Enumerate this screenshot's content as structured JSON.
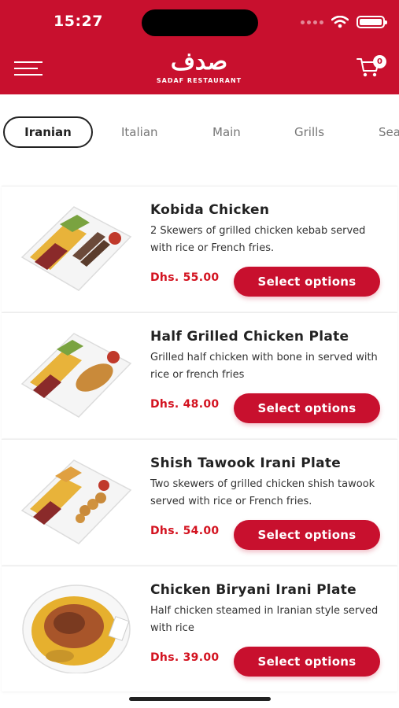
{
  "status_bar": {
    "time": "15:27"
  },
  "header": {
    "logo_mark": "صدف",
    "logo_sub": "SADAF RESTAURANT",
    "cart_count": "0"
  },
  "tabs": [
    {
      "label": "Iranian",
      "active": true
    },
    {
      "label": "Italian",
      "active": false
    },
    {
      "label": "Main",
      "active": false
    },
    {
      "label": "Grills",
      "active": false
    },
    {
      "label": "Sea",
      "active": false
    }
  ],
  "items": [
    {
      "title": "Kobida Chicken",
      "description": "2 Skewers of grilled chicken kebab served with rice or French fries.",
      "price": "Dhs. 55.00",
      "button": "Select options"
    },
    {
      "title": "Half Grilled Chicken Plate",
      "description": "Grilled half chicken with bone in served with rice or french fries",
      "price": "Dhs. 48.00",
      "button": "Select options"
    },
    {
      "title": "Shish Tawook Irani Plate",
      "description": "Two skewers of grilled chicken shish tawook served with rice or French fries.",
      "price": "Dhs. 54.00",
      "button": "Select options"
    },
    {
      "title": "Chicken Biryani Irani Plate",
      "description": "Half chicken steamed in Iranian style served with rice",
      "price": "Dhs. 39.00",
      "button": "Select options"
    }
  ],
  "colors": {
    "brand": "#c8102e",
    "price": "#d3121f"
  }
}
